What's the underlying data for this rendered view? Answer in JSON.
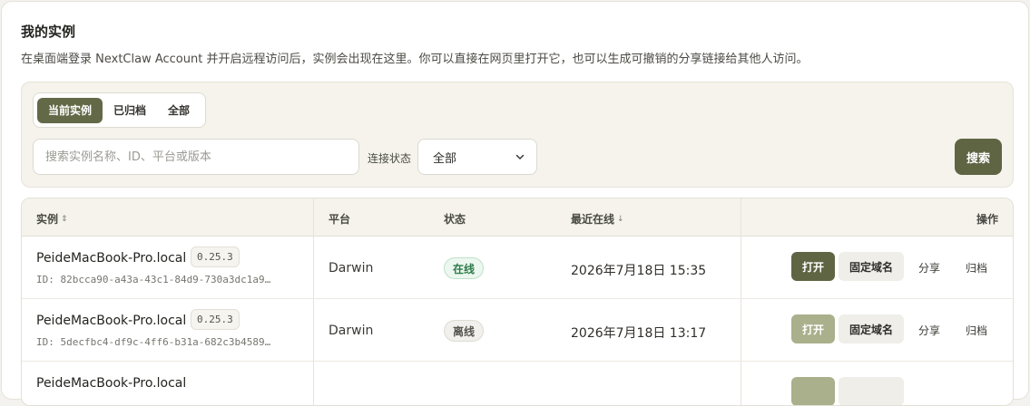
{
  "header": {
    "title": "我的实例",
    "description": "在桌面端登录 NextClaw Account 并开启远程访问后，实例会出现在这里。你可以直接在网页里打开它，也可以生成可撤销的分享链接给其他人访问。"
  },
  "filters": {
    "tabs": [
      {
        "label": "当前实例",
        "active": true
      },
      {
        "label": "已归档",
        "active": false
      },
      {
        "label": "全部",
        "active": false
      }
    ],
    "search_placeholder": "搜索实例名称、ID、平台或版本",
    "search_value": "",
    "connection_label": "连接状态",
    "connection_selected": "全部",
    "search_button": "搜索"
  },
  "table": {
    "columns": {
      "instance": "实例",
      "platform": "平台",
      "status": "状态",
      "last_online": "最近在线",
      "actions": "操作"
    },
    "rows": [
      {
        "name": "PeideMacBook-Pro.local",
        "version": "0.25.3",
        "id": "ID: 82bcca90-a43a-43c1-84d9-730a3dc1a9…",
        "platform": "Darwin",
        "status": "在线",
        "status_kind": "online",
        "last_online": "2026年7月18日 15:35",
        "open_label": "打开",
        "open_enabled": true,
        "domain_label": "固定域名",
        "share_label": "分享",
        "archive_label": "归档"
      },
      {
        "name": "PeideMacBook-Pro.local",
        "version": "0.25.3",
        "id": "ID: 5decfbc4-df9c-4ff6-b31a-682c3b4589…",
        "platform": "Darwin",
        "status": "离线",
        "status_kind": "offline",
        "last_online": "2026年7月18日 13:17",
        "open_label": "打开",
        "open_enabled": false,
        "domain_label": "固定域名",
        "share_label": "分享",
        "archive_label": "归档"
      }
    ],
    "partial_row_name": "PeideMacBook-Pro.local"
  },
  "colors": {
    "accent": "#5f6543",
    "accent_disabled": "#a9b08b",
    "online": "#2f7a4a"
  },
  "icons": {
    "sort_instance": "sort-both-icon",
    "sort_last_online": "arrow-down-icon",
    "select_chevron": "chevron-down-icon"
  }
}
